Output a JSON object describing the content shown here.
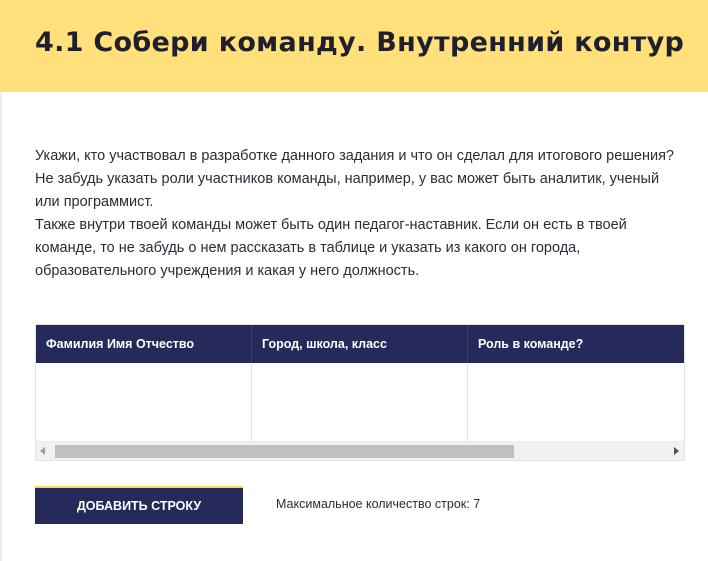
{
  "header": {
    "title": "4.1 Собери команду. Внутренний контур"
  },
  "description": {
    "paragraphs": [
      "Укажи, кто участвовал в разработке данного задания и что он сделал для итогового решения?",
      "Не забудь указать роли участников команды, например, у вас может быть аналитик, ученый или программист.",
      "Также внутри твоей команды может быть один педагог-наставник. Если он есть в твоей команде, то не забудь о нем рассказать в таблице и указать из какого он города, образовательного учреждения и какая у него должность."
    ]
  },
  "table": {
    "headers": [
      "Фамилия Имя Отчество",
      "Город, школа, класс",
      "Роль в команде?"
    ],
    "rows": [
      [
        "",
        "",
        ""
      ]
    ]
  },
  "actions": {
    "add_row_label": "ДОБАВИТЬ СТРОКУ",
    "max_rows_text": "Максимальное количество строк: 7"
  },
  "colors": {
    "header_background": "#ffe07a",
    "accent_navy": "#262a5a",
    "button_top_border": "#ffd85a"
  },
  "icons": {
    "scroll_left": "scroll-left-arrow-icon",
    "scroll_right": "scroll-right-arrow-icon"
  }
}
